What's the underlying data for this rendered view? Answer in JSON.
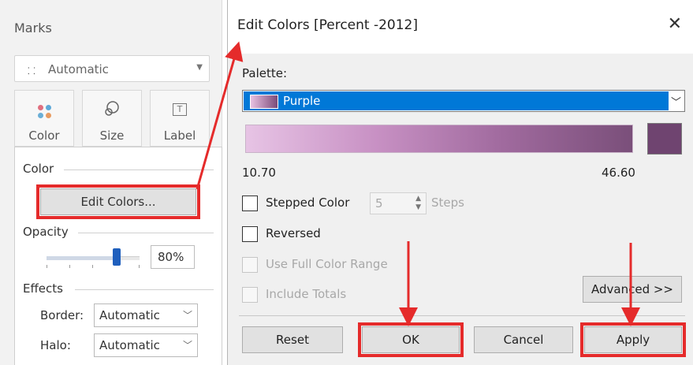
{
  "marks_panel": {
    "title": "Marks",
    "mark_type": {
      "icon": "auto-mark-icon",
      "value": "Automatic"
    },
    "buttons": [
      {
        "name": "color",
        "label": "Color",
        "icon": "color-dots-icon"
      },
      {
        "name": "size",
        "label": "Size",
        "icon": "size-icon"
      },
      {
        "name": "label",
        "label": "Label",
        "icon": "label-icon"
      }
    ],
    "color_popup": {
      "color_section": "Color",
      "edit_colors_label": "Edit Colors...",
      "opacity_section": "Opacity",
      "opacity_value": "80%",
      "opacity_fraction": 0.8,
      "effects_section": "Effects",
      "border_label": "Border:",
      "border_value": "Automatic",
      "halo_label": "Halo:",
      "halo_value": "Automatic"
    }
  },
  "dialog": {
    "title": "Edit Colors [Percent -2012]",
    "close_icon": "close-icon",
    "palette_label": "Palette:",
    "palette_value": "Purple",
    "range_min": "10.70",
    "range_max": "46.60",
    "colors": {
      "start": "#e7c4e5",
      "end": "#6f4470",
      "selection": "#0078d7"
    },
    "stepped_color_label": "Stepped Color",
    "steps_value": "5",
    "steps_label": "Steps",
    "reversed_label": "Reversed",
    "full_range_label": "Use Full Color Range",
    "include_totals_label": "Include Totals",
    "advanced_label": "Advanced >>",
    "reset_label": "Reset",
    "ok_label": "OK",
    "cancel_label": "Cancel",
    "apply_label": "Apply"
  },
  "annotation": {
    "highlight_color": "#e52b2b"
  }
}
